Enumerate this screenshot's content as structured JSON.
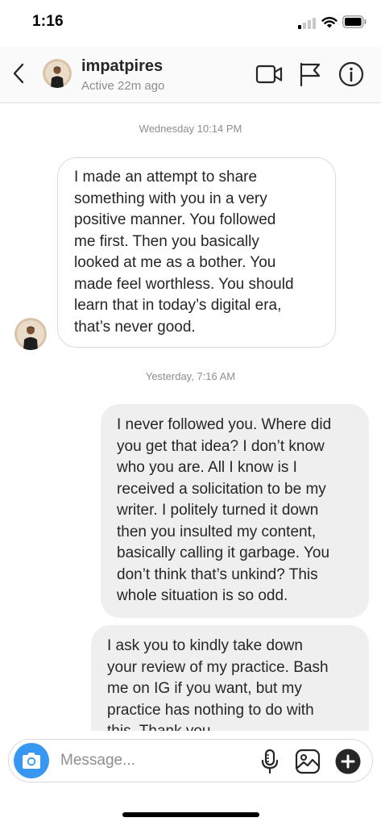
{
  "status_bar": {
    "time": "1:16",
    "icons": [
      "cellular-signal-icon",
      "wifi-icon",
      "battery-icon"
    ]
  },
  "header": {
    "username": "impatpires",
    "active_status": "Active 22m ago",
    "icons": [
      "back-chevron-icon",
      "video-call-icon",
      "flag-icon",
      "info-icon"
    ]
  },
  "conversation": {
    "groups": [
      {
        "timestamp": "Wednesday 10:14 PM",
        "messages": [
          {
            "direction": "incoming",
            "lines": [
              "I made an attempt to share",
              "something with you in a very",
              "positive manner.  You followed",
              "me first.  Then you basically",
              "looked at me as a bother.  You",
              "made feel worthless.  You should",
              "learn that in today’s digital era,",
              "that’s never good."
            ]
          }
        ]
      },
      {
        "timestamp": "Yesterday, 7:16 AM",
        "messages": [
          {
            "direction": "outgoing",
            "lines": [
              "I never followed you. Where did",
              "you get that idea? I don’t know",
              "who you are. All I know is I",
              "received a solicitation to be my",
              "writer. I politely turned it down",
              "then you insulted my content,",
              "basically calling it garbage. You",
              "don’t think that’s unkind? This",
              "whole situation is so odd."
            ]
          },
          {
            "direction": "outgoing",
            "lines": [
              "I ask you to kindly take down",
              "your review of my practice. Bash",
              "me on IG if you want, but my",
              "practice has nothing to do with",
              "this. Thank you."
            ]
          }
        ]
      }
    ]
  },
  "composer": {
    "placeholder": "Message...",
    "value": "",
    "icons": [
      "camera-icon",
      "microphone-icon",
      "gallery-icon",
      "plus-icon"
    ]
  },
  "colors": {
    "accent": "#3897f0",
    "outgoing_bubble": "#efefef",
    "incoming_border": "#dbdbdb",
    "secondary_text": "#8e8e8e"
  }
}
